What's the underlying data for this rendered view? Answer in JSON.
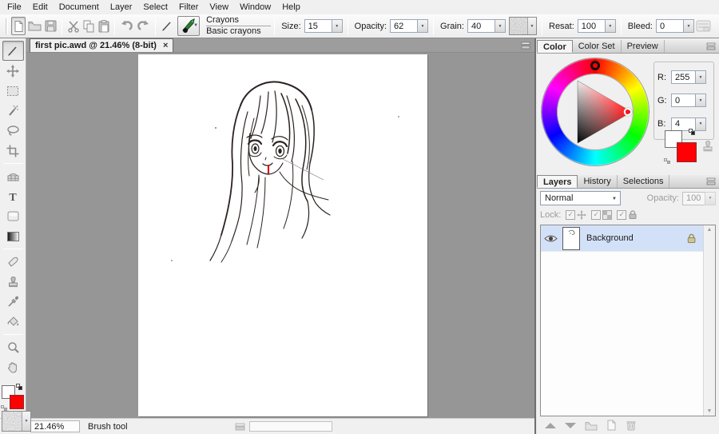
{
  "menu": {
    "items": [
      "File",
      "Edit",
      "Document",
      "Layer",
      "Select",
      "Filter",
      "View",
      "Window",
      "Help"
    ]
  },
  "toolbar": {
    "preset_name": "Crayons",
    "preset_variant": "Basic crayons",
    "size_label": "Size:",
    "size_value": "15",
    "opacity_label": "Opacity:",
    "opacity_value": "62",
    "grain_label": "Grain:",
    "grain_value": "40",
    "resat_label": "Resat:",
    "resat_value": "100",
    "bleed_label": "Bleed:",
    "bleed_value": "0"
  },
  "tab": {
    "title": "first pic.awd @ 21.46% (8-bit)",
    "close": "×"
  },
  "tools": [
    "brush",
    "move",
    "rect-select",
    "magic-wand",
    "lasso",
    "crop",
    "pattern",
    "text",
    "shape",
    "gradient",
    "eraser",
    "clone-stamp",
    "eyedropper",
    "paint-bucket",
    "zoom",
    "hand"
  ],
  "color_panel": {
    "tabs": [
      "Color",
      "Color Set",
      "Preview"
    ],
    "active_tab": "Color",
    "r_label": "R:",
    "r_value": "255",
    "g_label": "G:",
    "g_value": "0",
    "b_label": "B:",
    "b_value": "4",
    "foreground_color": "#ff0004",
    "background_color": "#ffffff"
  },
  "layers_panel": {
    "tabs": [
      "Layers",
      "History",
      "Selections"
    ],
    "active_tab": "Layers",
    "blend_mode": "Normal",
    "opacity_label": "Opacity:",
    "opacity_value": "100",
    "lock_label": "Lock:",
    "layers": [
      {
        "name": "Background",
        "visible": true,
        "locked": true
      }
    ]
  },
  "status": {
    "zoom": "21.46%",
    "tool": "Brush tool"
  }
}
